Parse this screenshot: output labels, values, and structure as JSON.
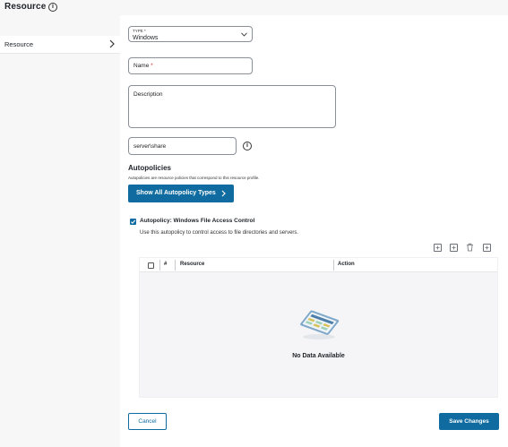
{
  "header": {
    "title": "Resource"
  },
  "sidebar": {
    "items": [
      {
        "label": "Resource"
      }
    ]
  },
  "form": {
    "type": {
      "label": "TYPE *",
      "value": "Windows"
    },
    "name": {
      "placeholder": "Name",
      "required_mark": "*"
    },
    "description": {
      "placeholder": "Description"
    },
    "path": {
      "value": "server\\share"
    }
  },
  "autopolicies": {
    "title": "Autopolicies",
    "subtitle": "Autopolicies are resource policies that correspond to this resource profile.",
    "show_button": "Show All Autopolicy Types",
    "policy": {
      "checked": true,
      "title": "Autopolicy: Windows File Access Control",
      "description": "Use this autopolicy to control access to file directories and servers."
    },
    "toolbar_icons": [
      "add-icon",
      "add-icon",
      "trash-icon",
      "add-icon"
    ]
  },
  "table": {
    "columns": [
      "#",
      "Resource",
      "Action"
    ],
    "rows": [],
    "empty_text": "No Data Available"
  },
  "footer": {
    "cancel": "Cancel",
    "save": "Save Changes"
  },
  "colors": {
    "primary": "#0f6ba0",
    "required": "#d0312d",
    "sidebar_bg": "#f7f7f8"
  }
}
